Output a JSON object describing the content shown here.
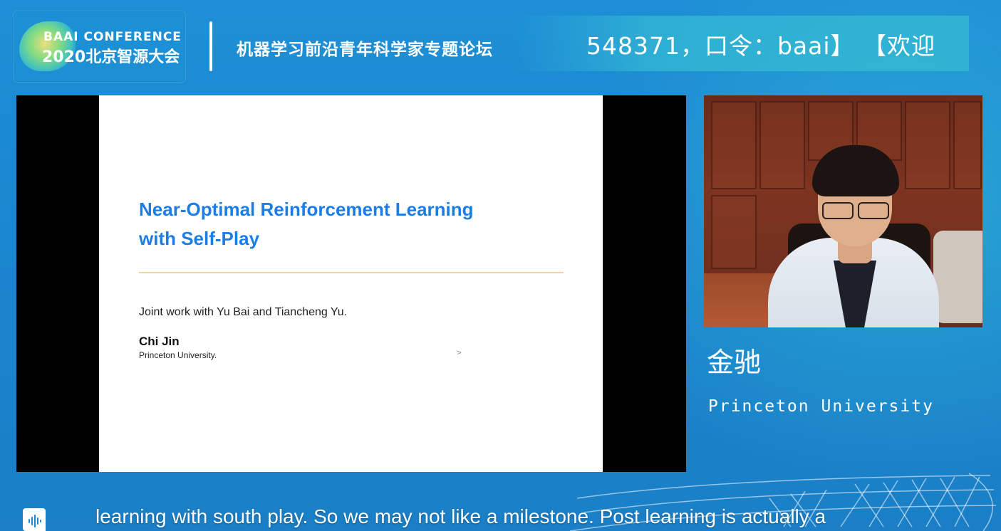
{
  "logo": {
    "line1": "BAAI CONFERENCE",
    "line2": "2020北京智源大会"
  },
  "header": {
    "forum_title": "机器学习前沿青年科学家专题论坛",
    "marquee": "548371，口令：baai】 【欢迎"
  },
  "slide": {
    "title_line1": "Near-Optimal Reinforcement Learning",
    "title_line2": "with Self-Play",
    "joint": "Joint work with Yu Bai and Tiancheng Yu.",
    "author": "Chi Jin",
    "affiliation": "Princeton University.",
    "nav_glyph": ">"
  },
  "speaker": {
    "name": "金驰",
    "affiliation": "Princeton University"
  },
  "caption": {
    "icon": "caption-icon",
    "text": "learning with south play. So we may not like a milestone. Post learning is actually a"
  },
  "colors": {
    "background": "#1a86cf",
    "slide_title": "#1a7ee6",
    "slide_rule": "#f2d49a"
  }
}
